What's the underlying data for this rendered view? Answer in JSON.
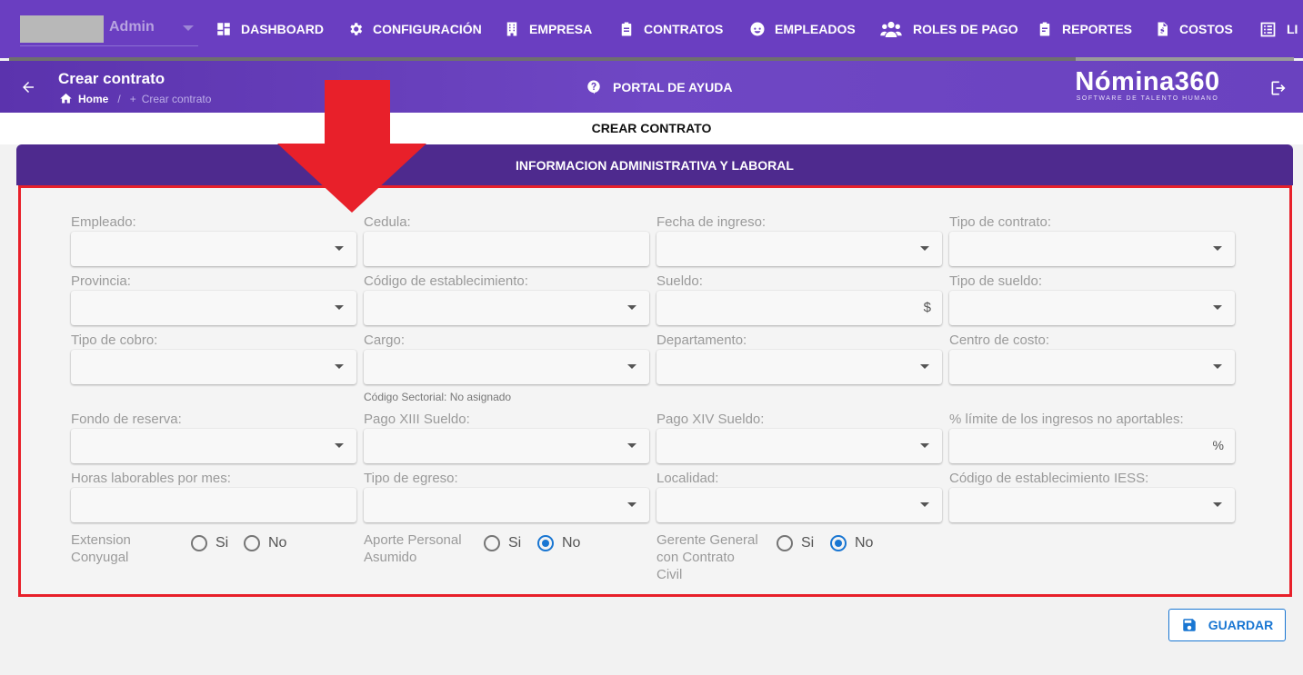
{
  "user": {
    "name": "Admin"
  },
  "colors": {
    "primary": "#6a3ec1",
    "card_header": "#4e2a8e",
    "accent": "#1976d2",
    "annotation": "#e8202a"
  },
  "nav": {
    "scroll_progress": 0.83,
    "items": [
      {
        "label": "DASHBOARD",
        "icon": "dashboard-icon"
      },
      {
        "label": "CONFIGURACIÓN",
        "icon": "gear-icon"
      },
      {
        "label": "EMPRESA",
        "icon": "building-icon"
      },
      {
        "label": "CONTRATOS",
        "icon": "clipboard-icon"
      },
      {
        "label": "EMPLEADOS",
        "icon": "face-icon"
      },
      {
        "label": "ROLES DE PAGO",
        "icon": "people-icon"
      },
      {
        "label": "REPORTES",
        "icon": "report-icon"
      },
      {
        "label": "COSTOS",
        "icon": "invoice-icon"
      },
      {
        "label": "LI",
        "icon": "list-icon"
      }
    ]
  },
  "header": {
    "title": "Crear contrato",
    "breadcrumb": {
      "home": "Home",
      "current": "Crear contrato"
    },
    "help": "PORTAL DE AYUDA",
    "brand": {
      "name": "Nómina360",
      "tagline": "SOFTWARE DE TALENTO HUMANO"
    }
  },
  "page": {
    "section_title": "CREAR CONTRATO",
    "card_title": "INFORMACION ADMINISTRATIVA Y LABORAL"
  },
  "form": {
    "rows": [
      [
        {
          "label": "Empleado:",
          "kind": "select"
        },
        {
          "label": "Cedula:",
          "kind": "text"
        },
        {
          "label": "Fecha de ingreso:",
          "kind": "select"
        },
        {
          "label": "Tipo de contrato:",
          "kind": "select"
        }
      ],
      [
        {
          "label": "Provincia:",
          "kind": "select"
        },
        {
          "label": "Código de establecimiento:",
          "kind": "select"
        },
        {
          "label": "Sueldo:",
          "kind": "text",
          "suffix": "$"
        },
        {
          "label": "Tipo de sueldo:",
          "kind": "select"
        }
      ],
      [
        {
          "label": "Tipo de cobro:",
          "kind": "select"
        },
        {
          "label": "Cargo:",
          "kind": "select",
          "hint": "Código Sectorial: No asignado"
        },
        {
          "label": "Departamento:",
          "kind": "select"
        },
        {
          "label": "Centro de costo:",
          "kind": "select"
        }
      ],
      [
        {
          "label": "Fondo de reserva:",
          "kind": "select"
        },
        {
          "label": "Pago XIII Sueldo:",
          "kind": "select"
        },
        {
          "label": "Pago XIV Sueldo:",
          "kind": "select"
        },
        {
          "label": "% límite de los ingresos no aportables:",
          "kind": "text",
          "suffix": "%"
        }
      ],
      [
        {
          "label": "Horas laborables por mes:",
          "kind": "text"
        },
        {
          "label": "Tipo de egreso:",
          "kind": "select"
        },
        {
          "label": "Localidad:",
          "kind": "select"
        },
        {
          "label": "Código de establecimiento IESS:",
          "kind": "select"
        }
      ]
    ],
    "radios": [
      {
        "label_lines": [
          "Extension",
          "Conyugal"
        ],
        "yes": "Si",
        "no": "No",
        "selected": "none"
      },
      {
        "label_lines": [
          "Aporte Personal",
          "Asumido"
        ],
        "yes": "Si",
        "no": "No",
        "selected": "No"
      },
      {
        "label_lines": [
          "Gerente General",
          "con Contrato",
          "Civil"
        ],
        "yes": "Si",
        "no": "No",
        "selected": "No"
      }
    ]
  },
  "actions": {
    "save": "GUARDAR"
  }
}
